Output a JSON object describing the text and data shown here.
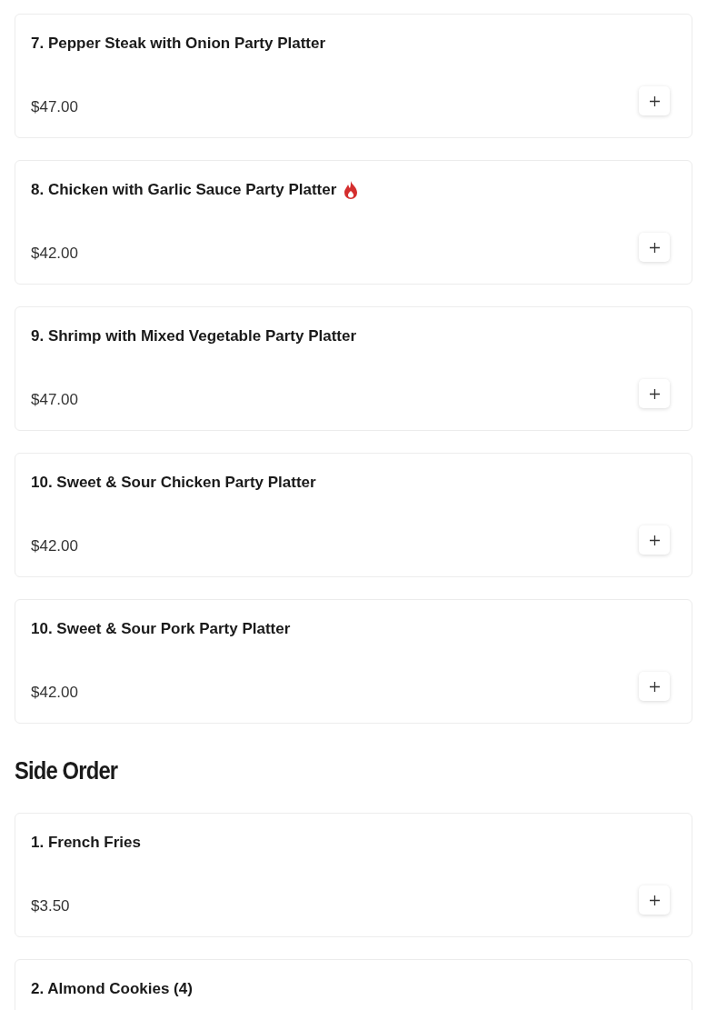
{
  "sections": [
    {
      "items": [
        {
          "name": "7. Pepper Steak with Onion Party Platter",
          "price": "$47.00",
          "spicy": false
        },
        {
          "name": "8. Chicken with Garlic Sauce Party Platter",
          "price": "$42.00",
          "spicy": true
        },
        {
          "name": "9. Shrimp with Mixed Vegetable Party Platter",
          "price": "$47.00",
          "spicy": false
        },
        {
          "name": "10. Sweet & Sour Chicken Party Platter",
          "price": "$42.00",
          "spicy": false
        },
        {
          "name": "10. Sweet & Sour Pork Party Platter",
          "price": "$42.00",
          "spicy": false
        }
      ]
    },
    {
      "heading": "Side Order",
      "items": [
        {
          "name": "1. French Fries",
          "price": "$3.50",
          "spicy": false
        },
        {
          "name": "2. Almond Cookies (4)",
          "spicy": false
        }
      ]
    }
  ]
}
